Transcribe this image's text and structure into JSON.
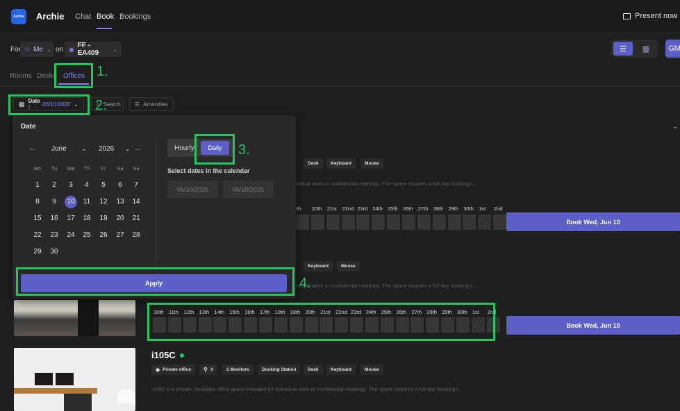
{
  "app": {
    "logo_text": "Archie",
    "name": "Archie"
  },
  "topnav": {
    "chat": "Chat",
    "book": "Book",
    "bookings": "Bookings",
    "present": "Present now"
  },
  "filters": {
    "for_label": "For",
    "person": "Me",
    "on_label": "on",
    "floor": "FF - EA409",
    "avatar": "GM"
  },
  "tabs": {
    "rooms": "Rooms",
    "desks": "Desks",
    "offices": "Offices"
  },
  "filterbar": {
    "date_label": "Date :",
    "date_value": "06/10/2026",
    "search": "Search",
    "amenities": "Amenities"
  },
  "popup": {
    "title": "Date",
    "month": "June",
    "year": "2026",
    "weekdays": [
      "Mo",
      "Tu",
      "We",
      "Th",
      "Fr",
      "Sa",
      "Su"
    ],
    "weeks": [
      [
        "1",
        "2",
        "3",
        "4",
        "5",
        "6",
        "7"
      ],
      [
        "8",
        "9",
        "10",
        "11",
        "12",
        "13",
        "14"
      ],
      [
        "15",
        "16",
        "17",
        "18",
        "19",
        "20",
        "21"
      ],
      [
        "22",
        "23",
        "24",
        "25",
        "26",
        "27",
        "28"
      ],
      [
        "29",
        "30",
        "",
        "",
        "",
        "",
        ""
      ]
    ],
    "selected_day": "10",
    "mode_hourly": "Hourly",
    "mode_daily": "Daily",
    "hint": "Select dates in the calendar",
    "start_date": "06/10/2026",
    "end_date": "06/10/2026",
    "apply": "Apply"
  },
  "steps": {
    "s1": "1.",
    "s2": "2.",
    "s3": "3.",
    "s4": "4."
  },
  "listing1": {
    "amenities_partial": [
      "Desk",
      "Keyboard",
      "Mouse"
    ],
    "desc_partial": "ividual work or confidential meetings. The space requires a full day booking t...",
    "date_labels": [
      "th",
      "20th",
      "21st",
      "22nd",
      "23rd",
      "24th",
      "25th",
      "26th",
      "27th",
      "28th",
      "29th",
      "30th",
      "1st",
      "2nd"
    ],
    "book": "Book Wed, Jun 10"
  },
  "listing2": {
    "amenities_partial": [
      "Keyboard",
      "Mouse"
    ],
    "desc_partial": "ividual work or confidential meetings. The space requires a full day booking t...",
    "date_labels": [
      "10th",
      "11th",
      "12th",
      "13th",
      "14th",
      "15th",
      "16th",
      "17th",
      "18th",
      "19th",
      "20th",
      "21st",
      "22nd",
      "23rd",
      "24th",
      "25th",
      "26th",
      "27th",
      "28th",
      "29th",
      "30th",
      "1st",
      "2nd"
    ],
    "book": "Book Wed, Jun 10"
  },
  "listing3": {
    "title": "i105C",
    "amenities": [
      "Private office",
      "3",
      "2 Monitors",
      "Docking Station",
      "Desk",
      "Keyboard",
      "Mouse"
    ],
    "desc": "i105C is a private, bookable office space intended for individual work or confidential meetings. The space requires a full day booking t..."
  },
  "colors": {
    "accent": "#5b5fc7",
    "annotation": "#22c55e",
    "available": "#22c55e"
  }
}
